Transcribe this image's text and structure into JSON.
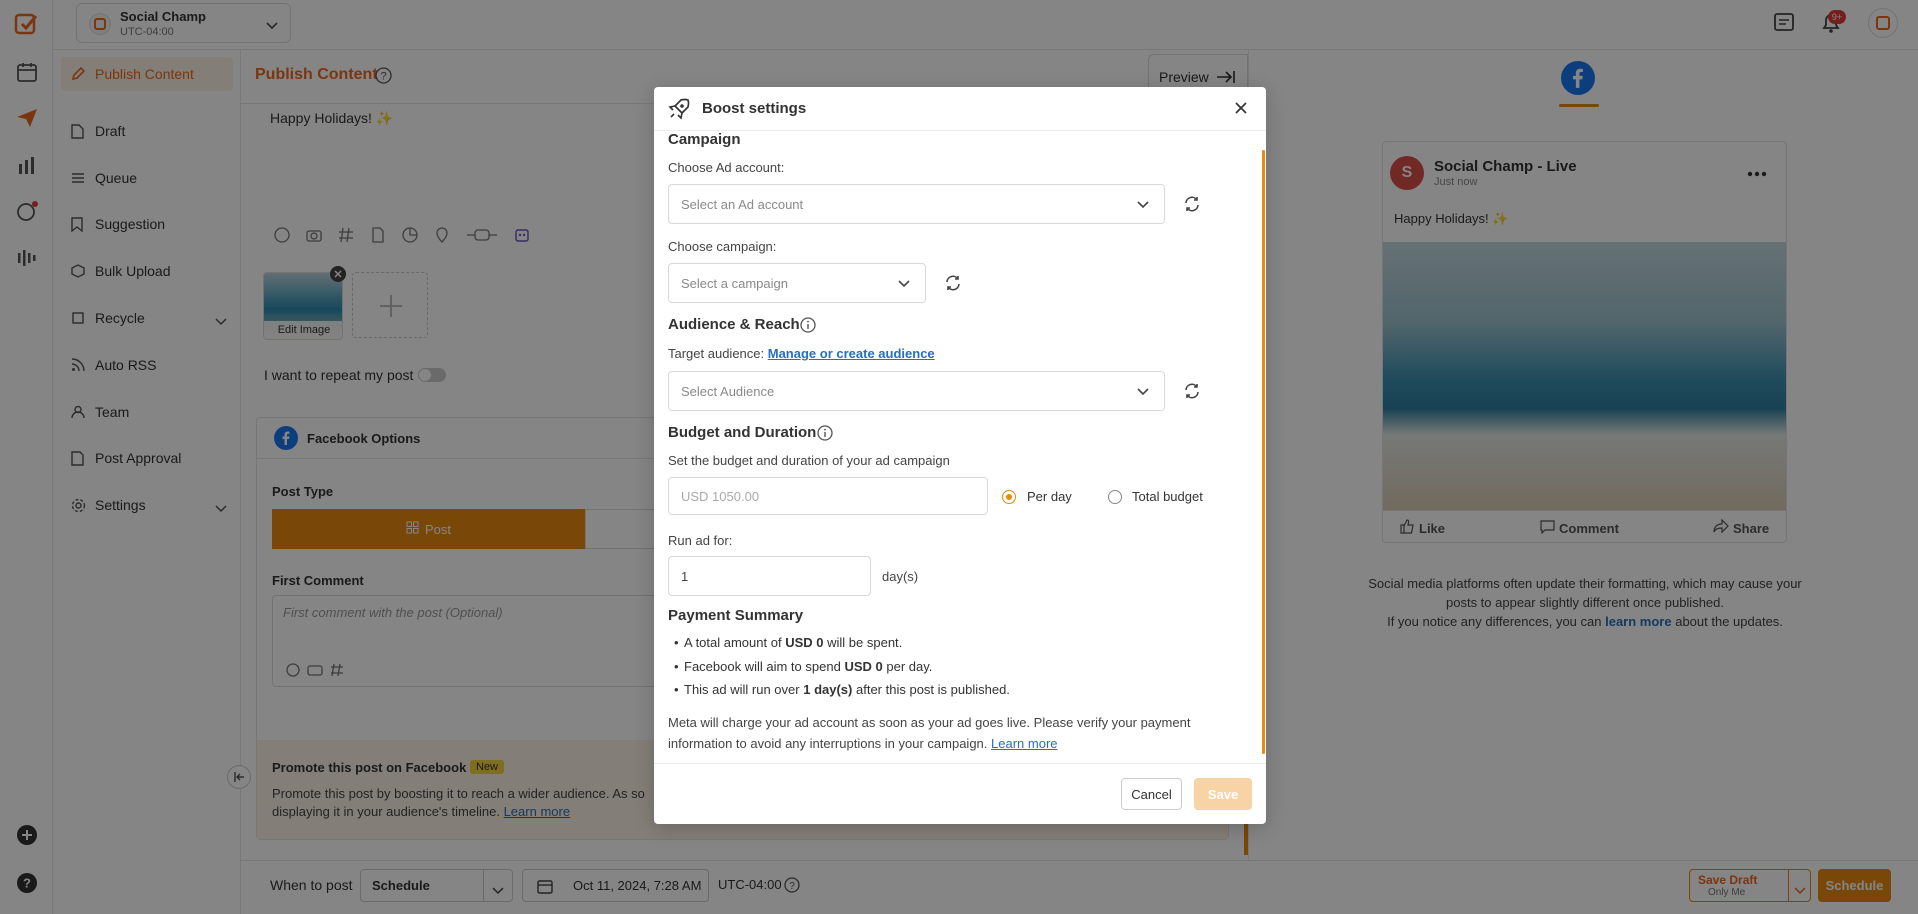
{
  "workspace": {
    "name": "Social Champ",
    "timezone": "UTC-04:00"
  },
  "topbar": {
    "notification_count": "9+"
  },
  "sidebar": {
    "items": [
      {
        "label": "Publish Content",
        "icon": "pen-icon"
      },
      {
        "label": "Draft",
        "icon": "document-icon"
      },
      {
        "label": "Queue",
        "icon": "list-icon"
      },
      {
        "label": "Suggestion",
        "icon": "bookmark-icon"
      },
      {
        "label": "Bulk Upload",
        "icon": "box-icon"
      },
      {
        "label": "Recycle",
        "icon": "recycle-icon"
      },
      {
        "label": "Auto RSS",
        "icon": "rss-icon"
      },
      {
        "label": "Team",
        "icon": "user-icon"
      },
      {
        "label": "Post Approval",
        "icon": "approval-icon"
      },
      {
        "label": "Settings",
        "icon": "gear-icon"
      }
    ]
  },
  "composer": {
    "title": "Publish Content",
    "post_text": "Happy Holidays! ✨",
    "edit_image_label": "Edit Image",
    "repeat_label": "I want to repeat my post",
    "fb_options_title": "Facebook Options",
    "post_type_label": "Post Type",
    "post_type_selected": "Post",
    "first_comment_label": "First Comment",
    "first_comment_placeholder": "First comment with the post (Optional)",
    "promote_title": "Promote this post on Facebook",
    "promote_badge": "New",
    "promote_text": "Promote this post by boosting it to reach a wider audience. As so",
    "promote_text2": "displaying it in your audience's timeline.",
    "promote_link": "Learn more"
  },
  "bottombar": {
    "when_label": "When to post",
    "schedule_option": "Schedule",
    "datetime": "Oct 11, 2024, 7:28 AM",
    "timezone": "UTC-04:00",
    "save_draft": "Save Draft",
    "save_draft_sub": "Only Me",
    "schedule_button": "Schedule"
  },
  "preview": {
    "button": "Preview",
    "account_name": "Social Champ - Live",
    "avatar_letter": "S",
    "time": "Just now",
    "post_text": "Happy Holidays! ✨",
    "actions": [
      "Like",
      "Comment",
      "Share"
    ],
    "note1": "Social media platforms often update their formatting, which may cause your",
    "note2": "posts to appear slightly different once published.",
    "note3": "If you notice any differences, you can",
    "note_link": "learn more",
    "note4": "about the updates."
  },
  "modal": {
    "title": "Boost settings",
    "campaign_section": "Campaign",
    "ad_account_label": "Choose Ad account:",
    "ad_account_placeholder": "Select an Ad account",
    "campaign_label": "Choose campaign:",
    "campaign_placeholder": "Select a campaign",
    "audience_section": "Audience & Reach",
    "target_label": "Target audience:",
    "target_link": "Manage or create audience",
    "audience_placeholder": "Select Audience",
    "budget_section": "Budget and Duration",
    "budget_desc": "Set the budget and duration of your ad campaign",
    "budget_placeholder": "USD 1050.00",
    "per_day": "Per day",
    "total_budget": "Total budget",
    "run_label": "Run ad for:",
    "run_value": "1",
    "days_unit": "day(s)",
    "summary_section": "Payment Summary",
    "s1a": "A total amount of",
    "s1b": "USD 0",
    "s1c": "will be spent.",
    "s2a": "Facebook will aim to spend",
    "s2b": "USD 0",
    "s2c": "per day.",
    "s3a": "This ad will run over",
    "s3b": "1 day(s)",
    "s3c": "after this post is published.",
    "meta_note1": "Meta will charge your ad account as soon as your ad goes live. Please verify your payment",
    "meta_note2": "information to avoid any interruptions in your campaign.",
    "meta_link": "Learn more",
    "cancel": "Cancel",
    "save": "Save"
  }
}
